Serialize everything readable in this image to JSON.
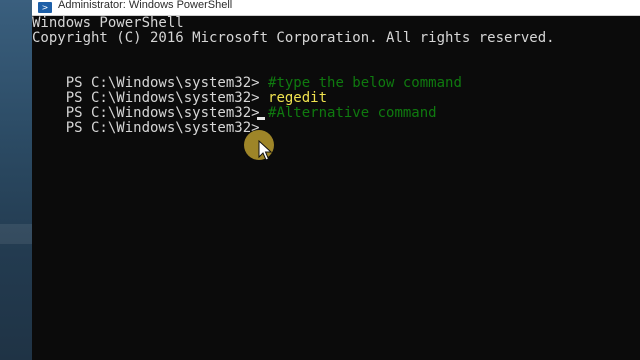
{
  "window": {
    "title": "Administrator: Windows PowerShell",
    "icon": "powershell-icon"
  },
  "console": {
    "header_line1": "Windows PowerShell",
    "header_line2": "Copyright (C) 2016 Microsoft Corporation. All rights reserved.",
    "lines": [
      {
        "prompt": "PS C:\\Windows\\system32> ",
        "text": "#type the below command"
      },
      {
        "prompt": "PS C:\\Windows\\system32> ",
        "text": "regedit"
      },
      {
        "prompt": "PS C:\\Windows\\system32> ",
        "text": "#Alternative command"
      },
      {
        "prompt": "PS C:\\Windows\\system32> ",
        "text": ""
      }
    ]
  },
  "colors": {
    "background": "#0b0b0b",
    "text": "#d6d6d6",
    "comment": "#0f7a0f",
    "command": "#f0e24f",
    "mouse_highlight": "#b89b2e"
  }
}
